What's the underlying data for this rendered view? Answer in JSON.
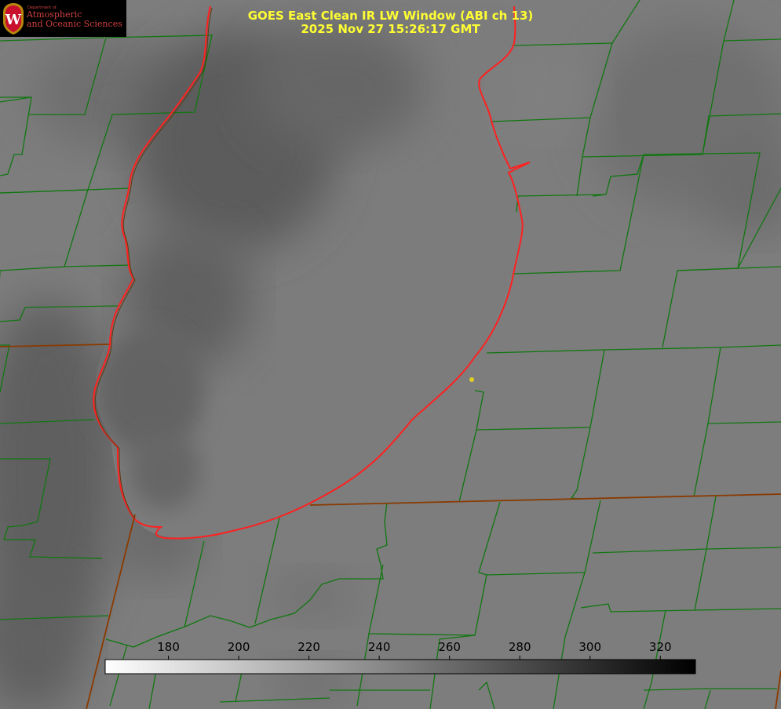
{
  "logo": {
    "department": "Department of",
    "line1": "Atmospheric",
    "line2": "and Oceanic Sciences",
    "crest_icon": "wisconsin-w-crest-icon"
  },
  "title": {
    "line1": "GOES East Clean IR LW Window (ABI ch 13)",
    "line2": "2025 Nov 27 15:26:17 GMT"
  },
  "colorbar": {
    "ticks": [
      180,
      200,
      220,
      240,
      260,
      280,
      300,
      320
    ],
    "range": [
      162,
      330
    ],
    "gradient": "white-to-black"
  },
  "colors": {
    "county_lines": "#117711",
    "state_lines": "#8a3a00",
    "lake_outline": "#ff2020",
    "title_text": "#ffff33",
    "location_dot": "#e0d020"
  }
}
